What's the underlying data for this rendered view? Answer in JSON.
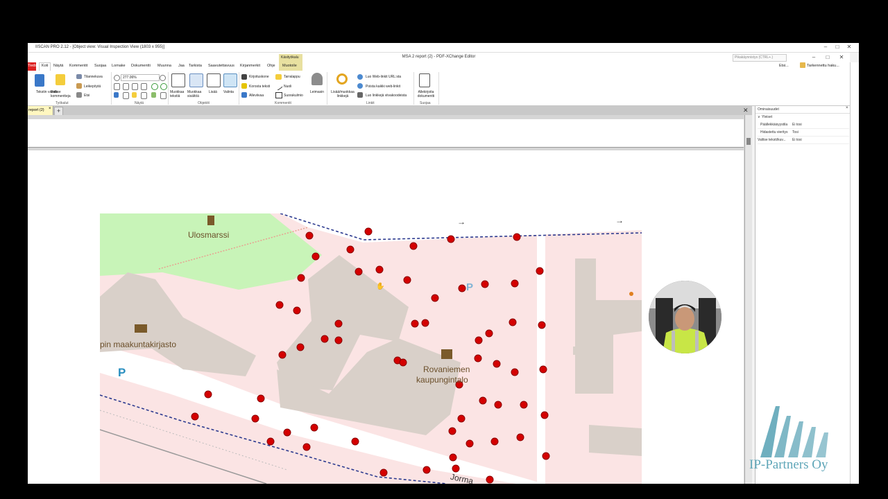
{
  "window": {
    "outer_title": "IISCAN PRO 2.12 - [Object view: Visual Inspection View (1803 x 955)]",
    "app_title": "MSA 2 report (2) - PDF-XChange Editor",
    "search_placeholder": "Pikakäynnistys (CTRL+.)",
    "find_label": "Etsi...",
    "advanced_search_label": "Tarkennettu haku..."
  },
  "menubar": {
    "items": [
      "Tiedosto",
      "Koti",
      "Näytä",
      "Kommentit",
      "Suojaa",
      "Lomake",
      "Dokumentti",
      "Muunna",
      "Jaa",
      "Tarkista",
      "Saavutettavuus",
      "Kirjanmerkit",
      "Ohje",
      "Muotoile"
    ],
    "contextual_header": "Käsityökalu",
    "active": "Koti"
  },
  "ribbon": {
    "tools": {
      "text_select": "Tekstin valinta",
      "comment_select": "Valitse kommentteja",
      "snapshot": "Tilannekuva",
      "clipboard": "Leikepöytä",
      "find": "Etsi",
      "group": "Työkalut"
    },
    "view": {
      "zoom": "277.06%",
      "group": "Näytä"
    },
    "objects": {
      "edit_text": "Muokkaa tekstiä",
      "edit_content": "Muokkaa sisältöä",
      "add": "Lisää",
      "select": "Valinta",
      "group": "Objektit"
    },
    "comments": {
      "typewriter": "Kirjoituskone",
      "highlight": "Korosta teksti",
      "underline": "Alleviivaa",
      "sticky": "Tarralappu",
      "arrow": "Nuoli",
      "rectangle": "Suorakulmio",
      "stamp": "Leimasin",
      "group": "Kommentit"
    },
    "links": {
      "add_edit": "Lisää/muokkaa linkkejä",
      "create_web": "Luo Web-linkit URL:sta",
      "remove_web": "Poista kaikki web-linkit",
      "create_from_lines": "Luo linkkejä viivakoodeista",
      "group": "Linkit"
    },
    "protect": {
      "sign": "Allekirjoita dokumentti",
      "group": "Suojaa"
    }
  },
  "tab": {
    "label": "report (2)"
  },
  "properties": {
    "title": "Ominaisuudet",
    "section": "Yleiset",
    "rows": [
      {
        "label": "Päällekkäisyystila",
        "value": "Ei tosi"
      },
      {
        "label": "Hidastettu vieritys",
        "value": "Tosi"
      },
      {
        "label": "Valitse teksti/kuv...",
        "value": "Ei tosi"
      }
    ]
  },
  "map": {
    "labels": {
      "ulosmarssi": "Ulosmarssi",
      "library": "pin maakuntakirjasto",
      "city_hall_1": "Rovaniemen",
      "city_hall_2": "kaupungintalo",
      "street": "Jorma",
      "parking": "P"
    }
  },
  "logo": {
    "text": "IP-Partners Oy"
  },
  "colors": {
    "marker": "#d40000",
    "marker_stroke": "#8a0000",
    "park": "#c8f4b8",
    "building": "#d9d0c9",
    "road": "#ffffff",
    "boundary": "#2c3a8f"
  }
}
